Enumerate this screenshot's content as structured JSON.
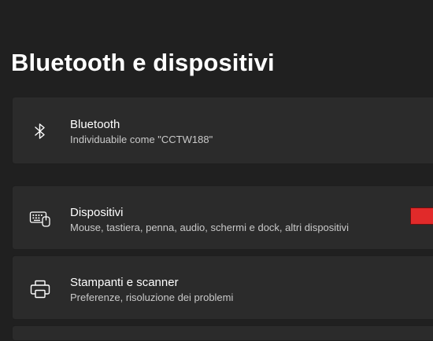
{
  "page": {
    "title": "Bluetooth e dispositivi"
  },
  "cards": {
    "bluetooth": {
      "icon": "bluetooth-icon",
      "title": "Bluetooth",
      "subtitle": "Individuabile come \"CCTW188\""
    },
    "devices": {
      "icon": "keyboard-devices-icon",
      "title": "Dispositivi",
      "subtitle": "Mouse, tastiera, penna, audio, schermi e dock, altri dispositivi",
      "marker_color": "#e12a2a"
    },
    "printers": {
      "icon": "printer-icon",
      "title": "Stampanti e scanner",
      "subtitle": "Preferenze, risoluzione dei problemi"
    }
  },
  "colors": {
    "background": "#202020",
    "card": "#2b2b2b",
    "text_primary": "#ffffff",
    "text_secondary": "#c9c9c9"
  }
}
